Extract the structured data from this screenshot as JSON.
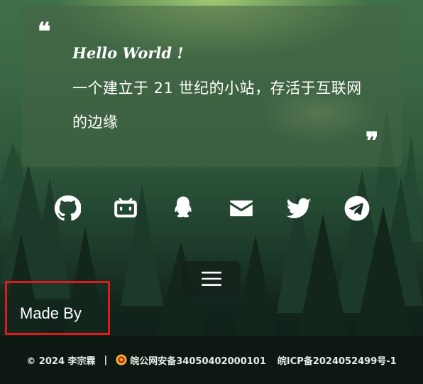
{
  "card": {
    "greeting": "Hello World !",
    "motto": "一个建立于 21 世纪的小站，存活于互联网的边缘",
    "quote_open": "❝",
    "quote_close": "❞"
  },
  "social_icons": [
    "github-icon",
    "bilibili-icon",
    "qq-icon",
    "mail-icon",
    "twitter-icon",
    "telegram-icon"
  ],
  "menu": {
    "icon": "menu-icon"
  },
  "made_by": {
    "label": "Made By",
    "highlight_color": "#e0191d"
  },
  "footer": {
    "copyright": "© 2024 李宗霖",
    "separator": "|",
    "police_record": "皖公网安备34050402000101",
    "icp_record": "皖ICP备2024052499号-1"
  }
}
